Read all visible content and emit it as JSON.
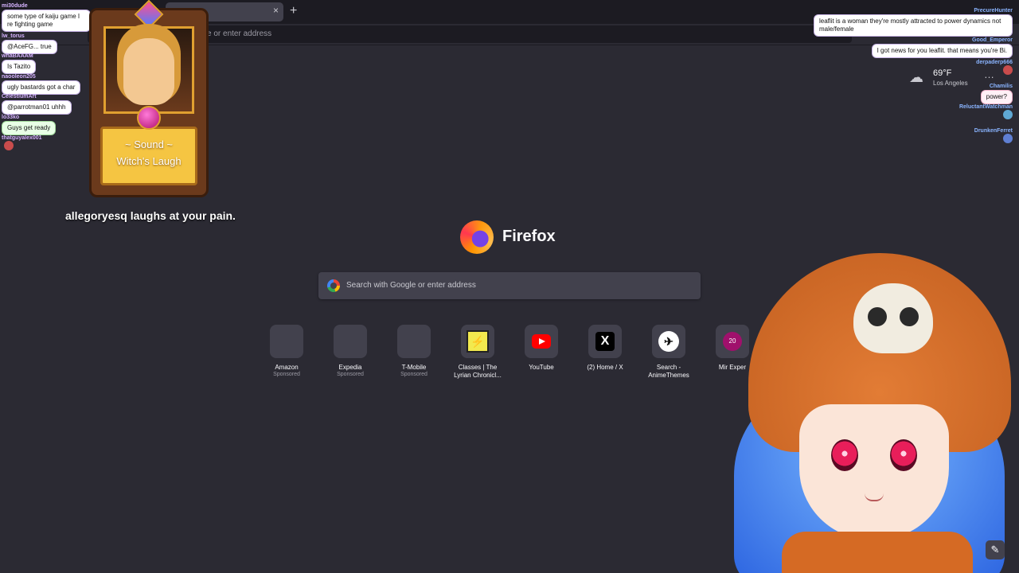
{
  "browser": {
    "url_placeholder": "e or enter address",
    "tab_close": "×",
    "new_tab": "+"
  },
  "newtab": {
    "brand": "Firefox",
    "search_placeholder": "Search with Google or enter address",
    "tiles": [
      {
        "label": "Amazon",
        "sponsor": "Sponsored"
      },
      {
        "label": "Expedia",
        "sponsor": "Sponsored"
      },
      {
        "label": "T-Mobile",
        "sponsor": "Sponsored"
      },
      {
        "label": "Classes | The Lyrian Chronicl...",
        "sponsor": ""
      },
      {
        "label": "YouTube",
        "sponsor": ""
      },
      {
        "label": "(2) Home / X",
        "sponsor": ""
      },
      {
        "label": "Search - AnimeThemes",
        "sponsor": ""
      },
      {
        "label": "Mir Exper",
        "sponsor": ""
      }
    ],
    "tile_icons": {
      "x": "X",
      "lyrian": "⚡",
      "anime": "✈",
      "mir": "20"
    },
    "weather": {
      "icon": "partly-cloudy-icon",
      "temp": "69°F",
      "city": "Los Angeles",
      "more": "…"
    },
    "edit_icon": "✎"
  },
  "chat_left": [
    {
      "name": "mi30dude",
      "message": "some type of kaiju game I re fighting game"
    },
    {
      "name": "lw_torus",
      "message": "@AceFG... true"
    },
    {
      "name": "whaBAAAM",
      "message": "Is Tazito"
    },
    {
      "name": "naooleon205",
      "message": "ugly bastards got a char"
    },
    {
      "name": "CelestiumArt",
      "message": "@parrotman01 uhhh"
    },
    {
      "name": "lo33ko",
      "message": "Guys get ready"
    },
    {
      "name": "thatguyalex001",
      "message": ""
    }
  ],
  "chat_right": [
    {
      "name": "PrecureHunter",
      "message": "leaflit is a woman they're mostly attracted to power dynamics not male/female"
    },
    {
      "name": "Good_Emperor",
      "message": "I got news for you leaflit. that means you're Bi."
    },
    {
      "name": "derpaderp666",
      "message": ""
    },
    {
      "name": "Chamilis",
      "message": "power?"
    },
    {
      "name": "ReluctantWatchman",
      "message": ""
    },
    {
      "name": "DrunkenFerret",
      "message": ""
    }
  ],
  "alert": {
    "title": "~ Sound ~",
    "subtitle": "Witch's Laugh",
    "message": "allegoryesq laughs at your pain."
  }
}
